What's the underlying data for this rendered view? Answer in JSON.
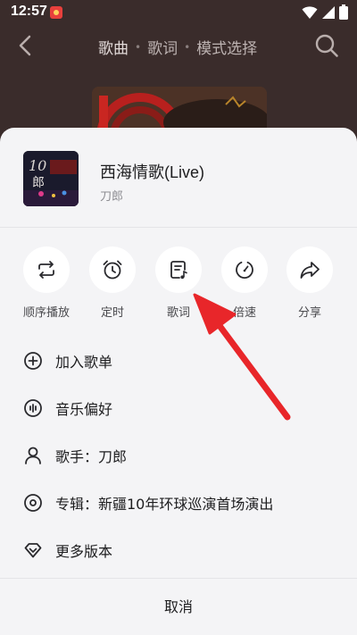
{
  "status_bar": {
    "time": "12:57"
  },
  "header": {
    "tabs": [
      {
        "label": "歌曲"
      },
      {
        "label": "歌词"
      },
      {
        "label": "模式选择"
      }
    ]
  },
  "song": {
    "title": "西海情歌(Live)",
    "artist": "刀郎"
  },
  "actions": [
    {
      "label": "顺序播放",
      "icon": "repeat-icon"
    },
    {
      "label": "定时",
      "icon": "alarm-clock-icon"
    },
    {
      "label": "歌词",
      "icon": "lyrics-icon"
    },
    {
      "label": "倍速",
      "icon": "speed-icon"
    },
    {
      "label": "分享",
      "icon": "share-icon"
    }
  ],
  "menu": [
    {
      "label": "加入歌单",
      "icon": "plus-circle-icon"
    },
    {
      "label": "音乐偏好",
      "icon": "music-preference-icon"
    },
    {
      "label": "歌手：刀郎",
      "icon": "user-icon"
    },
    {
      "label": "专辑：新疆10年环球巡演首场演出",
      "icon": "album-disc-icon"
    },
    {
      "label": "更多版本",
      "icon": "diamond-icon"
    }
  ],
  "cancel_label": "取消",
  "colors": {
    "backdrop": "#3a2c2b",
    "sheet": "#f4f4f6",
    "annotation_arrow": "#e8262a"
  }
}
